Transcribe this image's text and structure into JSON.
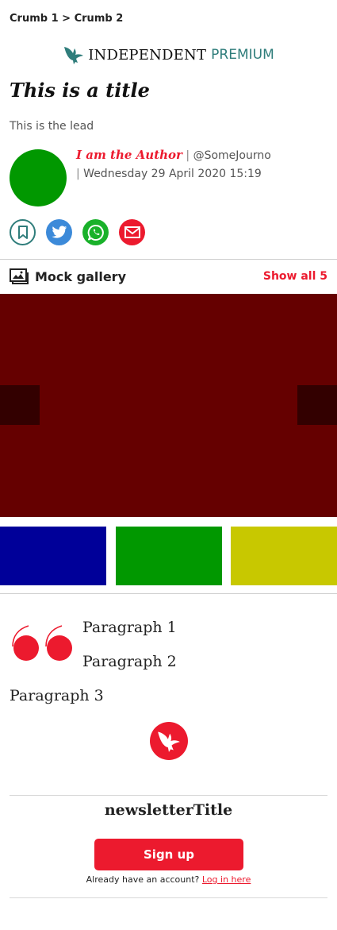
{
  "breadcrumb": {
    "items": [
      "Crumb 1",
      "Crumb 2"
    ],
    "separator": ">"
  },
  "masthead": {
    "brand": "INDEPENDENT",
    "tier": "PREMIUM"
  },
  "article": {
    "title": "This is a title",
    "lead": "This is the lead",
    "author": "I am the Author",
    "handle": "@SomeJourno",
    "date": "Wednesday 29 April 2020 15:19"
  },
  "share": [
    "bookmark-icon",
    "twitter-icon",
    "whatsapp-icon",
    "email-icon"
  ],
  "gallery": {
    "title": "Mock gallery",
    "show_all": "Show all 5",
    "main_color": "#650000",
    "thumb_colors": [
      "#000099",
      "#019800",
      "#c8c800"
    ]
  },
  "body": {
    "paragraphs": [
      "Paragraph 1",
      "Paragraph 2",
      "Paragraph 3"
    ]
  },
  "newsletter": {
    "title": "newsletterTitle",
    "signup": "Sign up",
    "account_text": "Already have an account?",
    "login": "Log in here"
  },
  "colors": {
    "accent": "#ec1a2e",
    "premium": "#2f7d7b",
    "twitter": "#3c8ad9",
    "whatsapp": "#19b12a"
  }
}
